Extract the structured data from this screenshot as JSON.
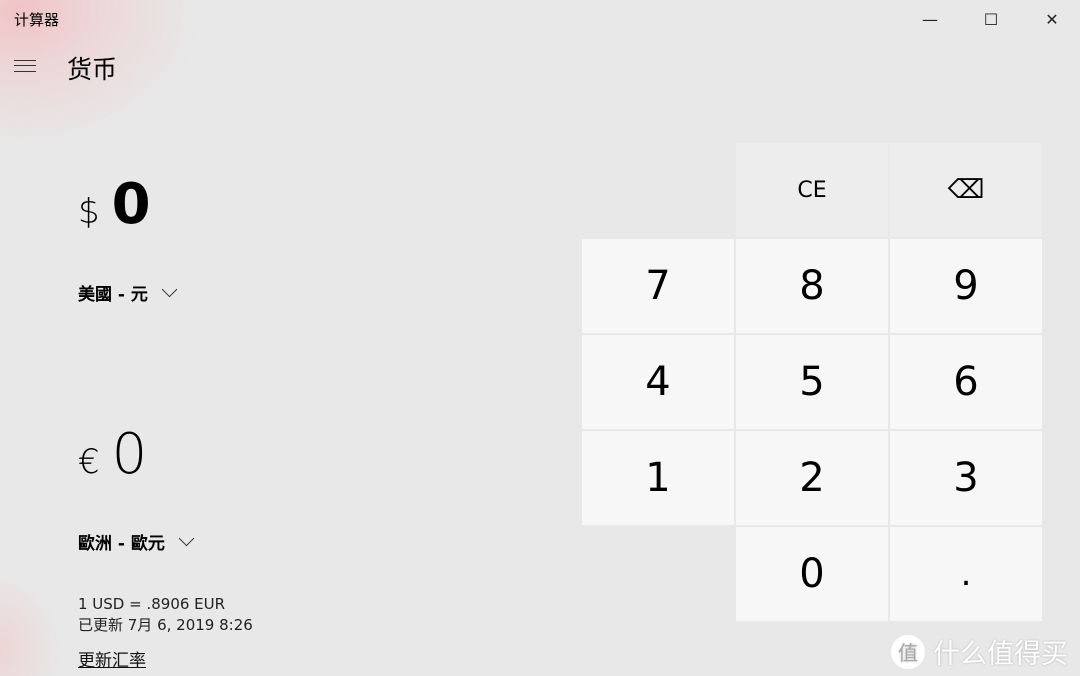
{
  "window": {
    "title": "计算器",
    "minimize": "—",
    "maximize": "☐",
    "close": "✕"
  },
  "header": {
    "mode": "货币"
  },
  "from": {
    "symbol": "$",
    "value": "0",
    "currency": "美國 - 元"
  },
  "to": {
    "symbol": "€",
    "value": "0",
    "currency": "歐洲 - 歐元"
  },
  "rate": {
    "line": "1 USD = .8906 EUR",
    "updated": "已更新 7月 6, 2019 8:26",
    "refresh_link": "更新汇率"
  },
  "keypad": {
    "ce": "CE",
    "backspace": "⌫",
    "k7": "7",
    "k8": "8",
    "k9": "9",
    "k4": "4",
    "k5": "5",
    "k6": "6",
    "k1": "1",
    "k2": "2",
    "k3": "3",
    "k0": "0",
    "dot": "."
  },
  "watermark": {
    "logo": "值",
    "text": "什么值得买"
  }
}
